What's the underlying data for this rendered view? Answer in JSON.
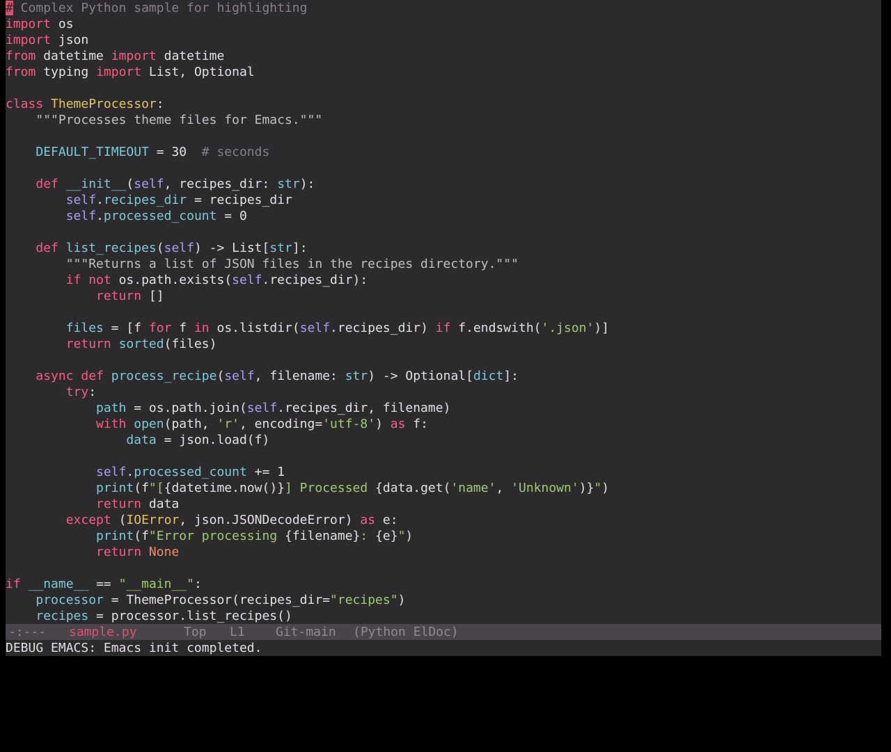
{
  "editor": {
    "lines": [
      [
        [
          "cursor",
          "#"
        ],
        [
          "comment",
          " Complex Python sample for highlighting"
        ]
      ],
      [
        [
          "keyword",
          "import"
        ],
        [
          "plain",
          " os"
        ]
      ],
      [
        [
          "keyword",
          "import"
        ],
        [
          "plain",
          " json"
        ]
      ],
      [
        [
          "keyword",
          "from"
        ],
        [
          "plain",
          " datetime "
        ],
        [
          "keyword",
          "import"
        ],
        [
          "plain",
          " datetime"
        ]
      ],
      [
        [
          "keyword",
          "from"
        ],
        [
          "plain",
          " typing "
        ],
        [
          "keyword",
          "import"
        ],
        [
          "plain",
          " List, Optional"
        ]
      ],
      [],
      [
        [
          "keyword",
          "class"
        ],
        [
          "plain",
          " "
        ],
        [
          "class",
          "ThemeProcessor"
        ],
        [
          "plain",
          ":"
        ]
      ],
      [
        [
          "plain",
          "    "
        ],
        [
          "docstring",
          "\"\"\"Processes theme files for Emacs.\"\"\""
        ]
      ],
      [],
      [
        [
          "plain",
          "    "
        ],
        [
          "var",
          "DEFAULT_TIMEOUT"
        ],
        [
          "plain",
          " = 30  "
        ],
        [
          "comment",
          "# seconds"
        ]
      ],
      [],
      [
        [
          "plain",
          "    "
        ],
        [
          "keyword",
          "def"
        ],
        [
          "plain",
          " "
        ],
        [
          "func",
          "__init__"
        ],
        [
          "plain",
          "("
        ],
        [
          "self",
          "self"
        ],
        [
          "plain",
          ", recipes_dir: "
        ],
        [
          "builtin",
          "str"
        ],
        [
          "plain",
          "):"
        ]
      ],
      [
        [
          "plain",
          "        "
        ],
        [
          "self",
          "self"
        ],
        [
          "plain",
          "."
        ],
        [
          "var",
          "recipes_dir"
        ],
        [
          "plain",
          " = recipes_dir"
        ]
      ],
      [
        [
          "plain",
          "        "
        ],
        [
          "self",
          "self"
        ],
        [
          "plain",
          "."
        ],
        [
          "var",
          "processed_count"
        ],
        [
          "plain",
          " = 0"
        ]
      ],
      [],
      [
        [
          "plain",
          "    "
        ],
        [
          "keyword",
          "def"
        ],
        [
          "plain",
          " "
        ],
        [
          "func",
          "list_recipes"
        ],
        [
          "plain",
          "("
        ],
        [
          "self",
          "self"
        ],
        [
          "plain",
          ") -> List["
        ],
        [
          "builtin",
          "str"
        ],
        [
          "plain",
          "]:"
        ]
      ],
      [
        [
          "plain",
          "        "
        ],
        [
          "docstring",
          "\"\"\"Returns a list of JSON files in the recipes directory.\"\"\""
        ]
      ],
      [
        [
          "plain",
          "        "
        ],
        [
          "keyword",
          "if"
        ],
        [
          "plain",
          " "
        ],
        [
          "keyword",
          "not"
        ],
        [
          "plain",
          " os.path.exists("
        ],
        [
          "self",
          "self"
        ],
        [
          "plain",
          ".recipes_dir):"
        ]
      ],
      [
        [
          "plain",
          "            "
        ],
        [
          "keyword",
          "return"
        ],
        [
          "plain",
          " []"
        ]
      ],
      [],
      [
        [
          "plain",
          "        "
        ],
        [
          "var",
          "files"
        ],
        [
          "plain",
          " = [f "
        ],
        [
          "keyword",
          "for"
        ],
        [
          "plain",
          " f "
        ],
        [
          "keyword",
          "in"
        ],
        [
          "plain",
          " os.listdir("
        ],
        [
          "self",
          "self"
        ],
        [
          "plain",
          ".recipes_dir) "
        ],
        [
          "keyword",
          "if"
        ],
        [
          "plain",
          " f.endswith("
        ],
        [
          "string",
          "'.json'"
        ],
        [
          "plain",
          ")]"
        ]
      ],
      [
        [
          "plain",
          "        "
        ],
        [
          "keyword",
          "return"
        ],
        [
          "plain",
          " "
        ],
        [
          "builtin",
          "sorted"
        ],
        [
          "plain",
          "(files)"
        ]
      ],
      [],
      [
        [
          "plain",
          "    "
        ],
        [
          "keyword",
          "async"
        ],
        [
          "plain",
          " "
        ],
        [
          "keyword",
          "def"
        ],
        [
          "plain",
          " "
        ],
        [
          "func",
          "process_recipe"
        ],
        [
          "plain",
          "("
        ],
        [
          "self",
          "self"
        ],
        [
          "plain",
          ", filename: "
        ],
        [
          "builtin",
          "str"
        ],
        [
          "plain",
          ") -> Optional["
        ],
        [
          "builtin",
          "dict"
        ],
        [
          "plain",
          "]:"
        ]
      ],
      [
        [
          "plain",
          "        "
        ],
        [
          "keyword",
          "try"
        ],
        [
          "plain",
          ":"
        ]
      ],
      [
        [
          "plain",
          "            "
        ],
        [
          "var",
          "path"
        ],
        [
          "plain",
          " = os.path.join("
        ],
        [
          "self",
          "self"
        ],
        [
          "plain",
          ".recipes_dir, filename)"
        ]
      ],
      [
        [
          "plain",
          "            "
        ],
        [
          "keyword",
          "with"
        ],
        [
          "plain",
          " "
        ],
        [
          "builtin",
          "open"
        ],
        [
          "plain",
          "(path, "
        ],
        [
          "string",
          "'r'"
        ],
        [
          "plain",
          ", encoding="
        ],
        [
          "string",
          "'utf-8'"
        ],
        [
          "plain",
          ") "
        ],
        [
          "keyword",
          "as"
        ],
        [
          "plain",
          " f:"
        ]
      ],
      [
        [
          "plain",
          "                "
        ],
        [
          "var",
          "data"
        ],
        [
          "plain",
          " = json.load(f)"
        ]
      ],
      [],
      [
        [
          "plain",
          "            "
        ],
        [
          "self",
          "self"
        ],
        [
          "plain",
          "."
        ],
        [
          "var",
          "processed_count"
        ],
        [
          "plain",
          " += 1"
        ]
      ],
      [
        [
          "plain",
          "            "
        ],
        [
          "builtin",
          "print"
        ],
        [
          "plain",
          "(f"
        ],
        [
          "string",
          "\"["
        ],
        [
          "plain",
          "{datetime.now()}"
        ],
        [
          "string",
          "] Processed "
        ],
        [
          "plain",
          "{data.get("
        ],
        [
          "string",
          "'name'"
        ],
        [
          "plain",
          ", "
        ],
        [
          "string",
          "'Unknown'"
        ],
        [
          "plain",
          ")}"
        ],
        [
          "string",
          "\""
        ],
        [
          "plain",
          ")"
        ]
      ],
      [
        [
          "plain",
          "            "
        ],
        [
          "keyword",
          "return"
        ],
        [
          "plain",
          " data"
        ]
      ],
      [
        [
          "plain",
          "        "
        ],
        [
          "keyword",
          "except"
        ],
        [
          "plain",
          " ("
        ],
        [
          "class",
          "IOError"
        ],
        [
          "plain",
          ", json.JSONDecodeError) "
        ],
        [
          "keyword",
          "as"
        ],
        [
          "plain",
          " e:"
        ]
      ],
      [
        [
          "plain",
          "            "
        ],
        [
          "builtin",
          "print"
        ],
        [
          "plain",
          "(f"
        ],
        [
          "string",
          "\"Error processing "
        ],
        [
          "plain",
          "{filename}"
        ],
        [
          "string",
          ": "
        ],
        [
          "plain",
          "{e}"
        ],
        [
          "string",
          "\""
        ],
        [
          "plain",
          ")"
        ]
      ],
      [
        [
          "plain",
          "            "
        ],
        [
          "keyword",
          "return"
        ],
        [
          "plain",
          " "
        ],
        [
          "constant",
          "None"
        ]
      ],
      [],
      [
        [
          "keyword",
          "if"
        ],
        [
          "plain",
          " "
        ],
        [
          "var",
          "__name__"
        ],
        [
          "plain",
          " == "
        ],
        [
          "string",
          "\"__main__\""
        ],
        [
          "plain",
          ":"
        ]
      ],
      [
        [
          "plain",
          "    "
        ],
        [
          "var",
          "processor"
        ],
        [
          "plain",
          " = ThemeProcessor(recipes_dir="
        ],
        [
          "string",
          "\"recipes\""
        ],
        [
          "plain",
          ")"
        ]
      ],
      [
        [
          "plain",
          "    "
        ],
        [
          "var",
          "recipes"
        ],
        [
          "plain",
          " = processor.list_recipes()"
        ]
      ]
    ]
  },
  "mode_line": {
    "status": "-:---",
    "buffer": "sample.py",
    "position": "Top",
    "line": "L1",
    "vc": "Git-main",
    "modes": "(Python ElDoc)"
  },
  "echo_area": {
    "message": "DEBUG EMACS: Emacs init completed."
  },
  "colors": {
    "background": "#2d2a2e",
    "foreground": "#e3e1e4",
    "keyword": "#f85e84",
    "class": "#e5c463",
    "function": "#7accd7",
    "self": "#ab9df2",
    "comment": "#848089",
    "string": "#9ecd6f",
    "constant": "#ef9062",
    "mode_line_bg": "#4a454d"
  }
}
